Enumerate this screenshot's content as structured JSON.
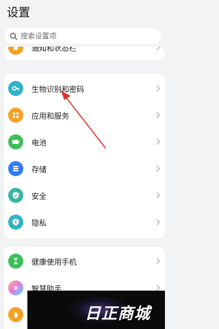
{
  "header": {
    "title": "设置"
  },
  "search": {
    "placeholder": "搜索设置项"
  },
  "top_partial": {
    "label": "通知和状态栏"
  },
  "group1": {
    "items": [
      {
        "label": "生物识别和密码",
        "icon": "key-icon",
        "color": "#2fb4c7"
      },
      {
        "label": "应用和服务",
        "icon": "apps-icon",
        "color": "#f4a124"
      },
      {
        "label": "电池",
        "icon": "battery-icon",
        "color": "#3bbf59"
      },
      {
        "label": "存储",
        "icon": "storage-icon",
        "color": "#2f7cf6"
      },
      {
        "label": "安全",
        "icon": "shield-icon",
        "color": "#37b6a4"
      },
      {
        "label": "隐私",
        "icon": "privacy-icon",
        "color": "#2fb4c7"
      }
    ]
  },
  "group2": {
    "items": [
      {
        "label": "健康使用手机",
        "icon": "hourglass-icon",
        "color": "#3bbf59"
      },
      {
        "label": "智慧助手",
        "icon": "assistant-icon",
        "color": "#b388ff"
      },
      {
        "label": "",
        "icon": "hand-icon",
        "color": "#f4a124"
      }
    ]
  },
  "watermark": {
    "text": "日正商城"
  },
  "annotation": {
    "color": "#e0322c"
  }
}
